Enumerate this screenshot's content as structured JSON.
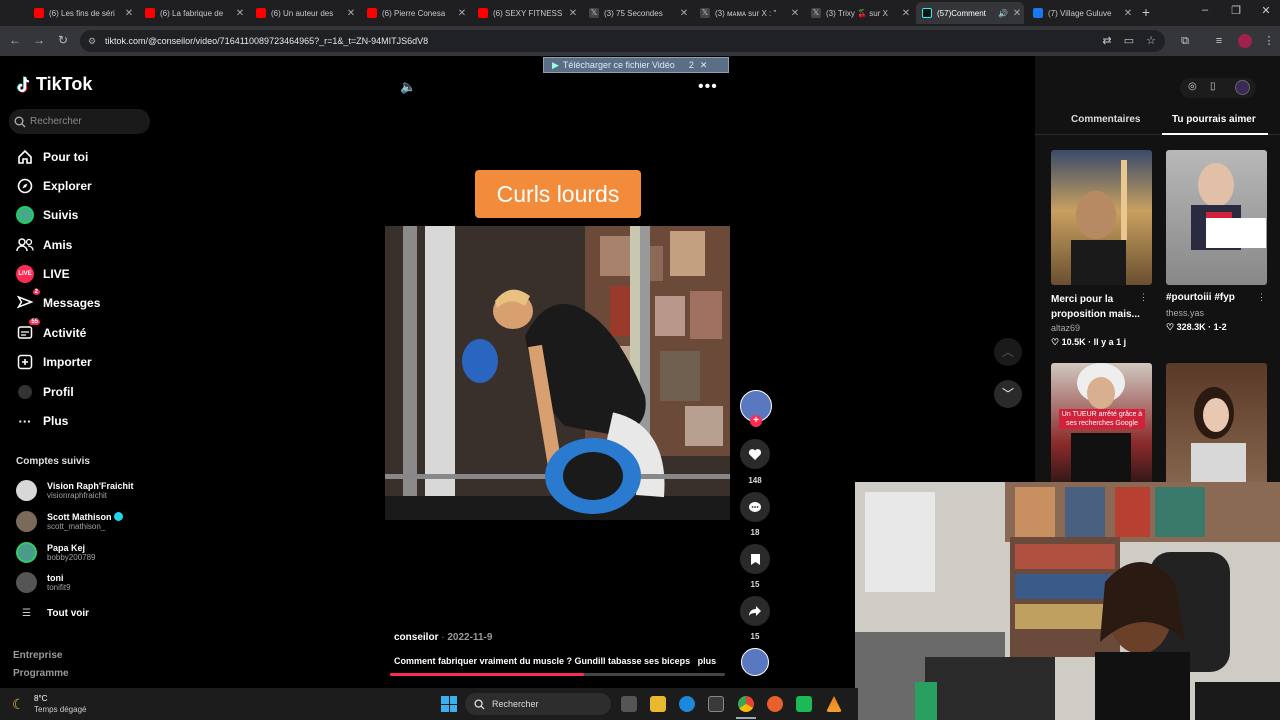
{
  "browser": {
    "tabs": [
      {
        "title": "(6) Les fins de séri",
        "icon": "youtube-icon",
        "color": "#ff0000"
      },
      {
        "title": "(6) La fabrique de",
        "icon": "youtube-icon",
        "color": "#ff0000"
      },
      {
        "title": "(6) Un auteur des",
        "icon": "youtube-icon",
        "color": "#ff0000"
      },
      {
        "title": "(6) Pierre Conesa",
        "icon": "youtube-icon",
        "color": "#ff0000"
      },
      {
        "title": "(6) SEXY FITNESS",
        "icon": "youtube-icon",
        "color": "#ff0000"
      },
      {
        "title": "(3) 75 Secondes",
        "icon": "x-icon",
        "color": "#000000"
      },
      {
        "title": "(3) ᴍᴀᴍᴀ sur X : \"",
        "icon": "x-icon",
        "color": "#000000"
      },
      {
        "title": "(3) Trixy 🍒 sur X",
        "icon": "x-icon",
        "color": "#000000"
      },
      {
        "title": "(57)Comment",
        "icon": "tiktok-icon",
        "color": "#000000",
        "active": true
      },
      {
        "title": "(7) Village Guluve",
        "icon": "facebook-icon",
        "color": "#1877f2"
      }
    ],
    "new_tab": "+",
    "window_controls": [
      "–",
      "❐",
      "✕"
    ],
    "url": "tiktok.com/@conseilor/video/7164110089723464965?_r=1&_t=ZN-94MITJS6dV8",
    "download_banner": "Télécharger ce fichier Vidéo",
    "download_banner_count": "2"
  },
  "tiktok": {
    "logo": "TikTok",
    "search_placeholder": "Rechercher",
    "nav": [
      {
        "label": "Pour toi",
        "icon": "home-icon"
      },
      {
        "label": "Explorer",
        "icon": "compass-icon"
      },
      {
        "label": "Suivis",
        "icon": "following-avatar-icon"
      },
      {
        "label": "Amis",
        "icon": "friends-icon"
      },
      {
        "label": "LIVE",
        "icon": "live-icon"
      },
      {
        "label": "Messages",
        "icon": "messages-icon",
        "badge": "2"
      },
      {
        "label": "Activité",
        "icon": "activity-icon",
        "badge": "55"
      },
      {
        "label": "Importer",
        "icon": "upload-icon"
      },
      {
        "label": "Profil",
        "icon": "profile-icon"
      },
      {
        "label": "Plus",
        "icon": "more-icon"
      }
    ],
    "followed_title": "Comptes suivis",
    "followed": [
      {
        "name": "Vision Raph'Fraichit",
        "handle": "visionraphfraichit",
        "verified": false
      },
      {
        "name": "Scott Mathison",
        "handle": "scott_mathison_",
        "verified": true
      },
      {
        "name": "Papa Kej",
        "handle": "bobby200789",
        "verified": false
      },
      {
        "name": "toni",
        "handle": "tonifit9",
        "verified": false
      }
    ],
    "see_all": "Tout voir",
    "footer_links": [
      "Entreprise",
      "Programme"
    ],
    "video": {
      "overlay_title": "Curls lourds",
      "author": "conseilor",
      "date": "2022-11-9",
      "caption": "Comment fabriquer vraiment du muscle ? Gundill tabasse ses biceps",
      "more": "plus",
      "progress": 0.58
    },
    "actions": [
      {
        "name": "like",
        "icon": "heart-icon",
        "count": "148"
      },
      {
        "name": "comment",
        "icon": "comment-icon",
        "count": "18"
      },
      {
        "name": "save",
        "icon": "bookmark-icon",
        "count": "15"
      },
      {
        "name": "share",
        "icon": "share-icon",
        "count": "15"
      }
    ],
    "panel_tabs": [
      "Commentaires",
      "Tu pourrais aimer"
    ],
    "suggestions": [
      {
        "title": "Merci pour la proposition mais...",
        "author": "altaz69",
        "likes": "10.5K",
        "meta": "Il y a 1 j"
      },
      {
        "title": "#pourtoiii #fyp",
        "author": "thess.yas",
        "likes": "328.3K",
        "meta": "1-2"
      },
      {
        "title": "",
        "author": "",
        "likes": "",
        "meta": "",
        "overlay": "Un TUEUR arrêté grâce à ses recherches Google"
      },
      {
        "title": "",
        "author": "",
        "likes": "",
        "meta": ""
      }
    ]
  },
  "taskbar": {
    "weather_temp": "8°C",
    "weather_desc": "Temps dégagé",
    "search_label": "Rechercher"
  }
}
